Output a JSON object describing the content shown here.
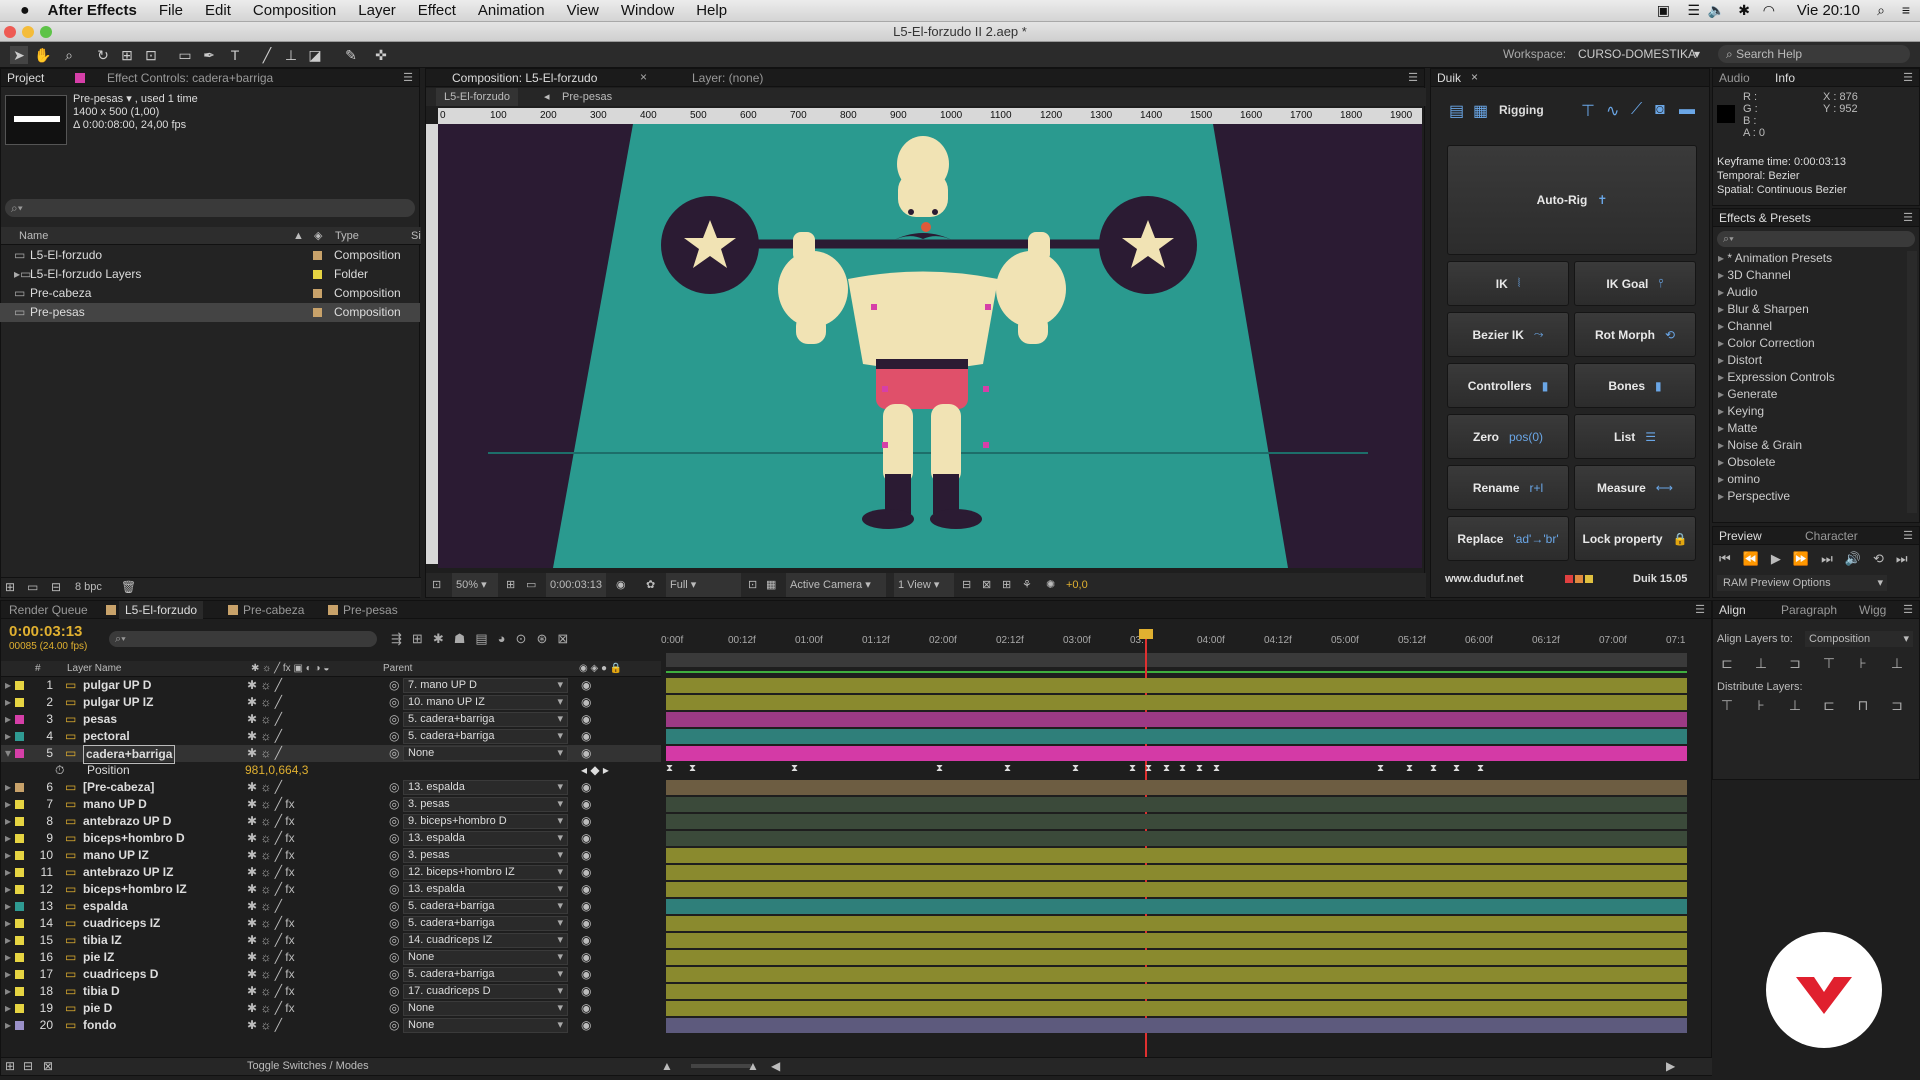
{
  "menubar": {
    "apple": "",
    "app": "After Effects",
    "items": [
      "File",
      "Edit",
      "Composition",
      "Layer",
      "Effect",
      "Animation",
      "View",
      "Window",
      "Help"
    ],
    "clock": "Vie 20:10"
  },
  "window": {
    "title": "L5-El-forzudo II 2.aep *"
  },
  "toolbar": {
    "workspace_label": "Workspace:",
    "workspace_value": "CURSO-DOMESTIKA",
    "search_help": "Search Help"
  },
  "project": {
    "tab_project": "Project",
    "tab_effect_controls": "Effect Controls: cadera+barriga",
    "preview_name": "Pre-pesas ▾ , used 1 time",
    "preview_size": "1400 x 500 (1,00)",
    "preview_duration": "Δ 0:00:08:00, 24,00 fps",
    "col_name": "Name",
    "col_type": "Type",
    "col_s": "Si",
    "items": [
      {
        "name": "L5-El-forzudo",
        "type": "Composition",
        "color": "#c8a26a"
      },
      {
        "name": "L5-El-forzudo Layers",
        "type": "Folder",
        "color": "#e6d442"
      },
      {
        "name": "Pre-cabeza",
        "type": "Composition",
        "color": "#c8a26a"
      },
      {
        "name": "Pre-pesas",
        "type": "Composition",
        "color": "#c8a26a"
      }
    ],
    "bpc": "8 bpc"
  },
  "comp": {
    "tab": "Composition: L5-El-forzudo",
    "layer_tab": "Layer: (none)",
    "crumbs": [
      "L5-El-forzudo",
      "Pre-pesas"
    ],
    "ruler": [
      "0",
      "100",
      "200",
      "300",
      "400",
      "500",
      "600",
      "700",
      "800",
      "900",
      "1000",
      "1100",
      "1200",
      "1300",
      "1400",
      "1500",
      "1600",
      "1700",
      "1800",
      "1900"
    ],
    "zoom": "50%",
    "timecode": "0:00:03:13",
    "resolution": "Full",
    "camera": "Active Camera",
    "views": "1 View",
    "exposure": "+0,0",
    "colors": {
      "bg": "#2b1b33",
      "floor": "#2a9a8f",
      "skin": "#f1e3b4",
      "dark": "#2b1b33"
    }
  },
  "duik": {
    "tab": "Duik",
    "rigging": "Rigging",
    "autorig": "Auto-Rig",
    "buttons": [
      {
        "label": "IK",
        "icon": "ik-icon"
      },
      {
        "label": "IK Goal",
        "icon": "ik-goal-icon"
      },
      {
        "label": "Bezier IK",
        "icon": "bezier-ik-icon"
      },
      {
        "label": "Rot Morph",
        "icon": "rot-morph-icon"
      },
      {
        "label": "Controllers",
        "icon": "controllers-icon"
      },
      {
        "label": "Bones",
        "icon": "bones-icon"
      },
      {
        "label": "Zero",
        "icon": "pos(0)"
      },
      {
        "label": "List",
        "icon": "list-icon"
      },
      {
        "label": "Rename",
        "icon": "rename-icon"
      },
      {
        "label": "Measure",
        "icon": "measure-icon"
      },
      {
        "label": "Replace",
        "icon": "replace-icon"
      },
      {
        "label": "Lock property",
        "icon": "lock-icon"
      }
    ],
    "zero_icon_text": "pos(0)",
    "replace_icon_text": "'ad'→'br'",
    "rename_icon_text": "r+l",
    "site": "www.duduf.net",
    "version": "Duik 15.05"
  },
  "info": {
    "tab_audio": "Audio",
    "tab_info": "Info",
    "r": "R :",
    "g": "G :",
    "b": "B :",
    "a": "A : 0",
    "x": "X : 876",
    "y": "Y : 952",
    "kf_time": "Keyframe time: 0:00:03:13",
    "temporal": "Temporal: Bezier",
    "spatial": "Spatial: Continuous Bezier"
  },
  "effects": {
    "tab": "Effects & Presets",
    "items": [
      "* Animation Presets",
      "3D Channel",
      "Audio",
      "Blur & Sharpen",
      "Channel",
      "Color Correction",
      "Distort",
      "Expression Controls",
      "Generate",
      "Keying",
      "Matte",
      "Noise & Grain",
      "Obsolete",
      "omino",
      "Perspective"
    ]
  },
  "preview": {
    "tab_preview": "Preview",
    "tab_character": "Character",
    "ram": "RAM Preview Options"
  },
  "align": {
    "tab_align": "Align",
    "tab_paragraph": "Paragraph",
    "tab_wiggle": "Wigg",
    "align_to_label": "Align Layers to:",
    "align_to_value": "Composition",
    "distribute": "Distribute Layers:"
  },
  "timeline": {
    "tabs": [
      "Render Queue",
      "L5-El-forzudo",
      "Pre-cabeza",
      "Pre-pesas"
    ],
    "timecode": "0:00:03:13",
    "fps": "00085 (24.00 fps)",
    "col_hash": "#",
    "col_name": "Layer Name",
    "col_parent": "Parent",
    "toggle": "Toggle Switches / Modes",
    "ticks": [
      "0:00f",
      "00:12f",
      "01:00f",
      "01:12f",
      "02:00f",
      "02:12f",
      "03:00f",
      "03:",
      "04:00f",
      "04:12f",
      "05:00f",
      "05:12f",
      "06:00f",
      "06:12f",
      "07:00f",
      "07:1"
    ],
    "position_label": "Position",
    "position_value": "981,0,664,3",
    "layers": [
      {
        "n": "1",
        "name": "pulgar UP D",
        "parent": "7. mano UP D",
        "color": "#e6d442",
        "bar": "#8a8a2e",
        "fx": false
      },
      {
        "n": "2",
        "name": "pulgar UP IZ",
        "parent": "10. mano UP IZ",
        "color": "#e6d442",
        "bar": "#8a8a2e",
        "fx": false
      },
      {
        "n": "3",
        "name": "pesas",
        "parent": "5. cadera+barriga",
        "color": "#d63fa8",
        "bar": "#9c3a85",
        "fx": false
      },
      {
        "n": "4",
        "name": "pectoral",
        "parent": "5. cadera+barriga",
        "color": "#2f9a92",
        "bar": "#2f7f7a",
        "fx": false
      },
      {
        "n": "5",
        "name": "cadera+barriga",
        "parent": "None",
        "color": "#d63fa8",
        "bar": "#d43aa6",
        "fx": false
      },
      {
        "n": "6",
        "name": "[Pre-cabeza]",
        "parent": "13. espalda",
        "color": "#c8a26a",
        "bar": "#6d5d42",
        "fx": false
      },
      {
        "n": "7",
        "name": "mano UP D",
        "parent": "3. pesas",
        "color": "#e6d442",
        "bar": "#3b4a3a",
        "fx": true
      },
      {
        "n": "8",
        "name": "antebrazo UP D",
        "parent": "9. biceps+hombro D",
        "color": "#e6d442",
        "bar": "#3b4a3a",
        "fx": true
      },
      {
        "n": "9",
        "name": "biceps+hombro D",
        "parent": "13. espalda",
        "color": "#e6d442",
        "bar": "#3b4a3a",
        "fx": true
      },
      {
        "n": "10",
        "name": "mano UP IZ",
        "parent": "3. pesas",
        "color": "#e6d442",
        "bar": "#8a8a2e",
        "fx": true
      },
      {
        "n": "11",
        "name": "antebrazo UP IZ",
        "parent": "12. biceps+hombro IZ",
        "color": "#e6d442",
        "bar": "#8a8a2e",
        "fx": true
      },
      {
        "n": "12",
        "name": "biceps+hombro IZ",
        "parent": "13. espalda",
        "color": "#e6d442",
        "bar": "#8a8a2e",
        "fx": true
      },
      {
        "n": "13",
        "name": "espalda",
        "parent": "5. cadera+barriga",
        "color": "#2f9a92",
        "bar": "#2f7f7a",
        "fx": false
      },
      {
        "n": "14",
        "name": "cuadriceps IZ",
        "parent": "5. cadera+barriga",
        "color": "#e6d442",
        "bar": "#8a8a2e",
        "fx": true
      },
      {
        "n": "15",
        "name": "tibia IZ",
        "parent": "14. cuadriceps IZ",
        "color": "#e6d442",
        "bar": "#8a8a2e",
        "fx": true
      },
      {
        "n": "16",
        "name": "pie IZ",
        "parent": "None",
        "color": "#e6d442",
        "bar": "#8a8a2e",
        "fx": true
      },
      {
        "n": "17",
        "name": "cuadriceps D",
        "parent": "5. cadera+barriga",
        "color": "#e6d442",
        "bar": "#8a8a2e",
        "fx": true
      },
      {
        "n": "18",
        "name": "tibia D",
        "parent": "17. cuadriceps D",
        "color": "#e6d442",
        "bar": "#8a8a2e",
        "fx": true
      },
      {
        "n": "19",
        "name": "pie D",
        "parent": "None",
        "color": "#e6d442",
        "bar": "#8a8a2e",
        "fx": true
      },
      {
        "n": "20",
        "name": "fondo",
        "parent": "None",
        "color": "#9a90c8",
        "bar": "#5d5a7d",
        "fx": false
      }
    ]
  }
}
